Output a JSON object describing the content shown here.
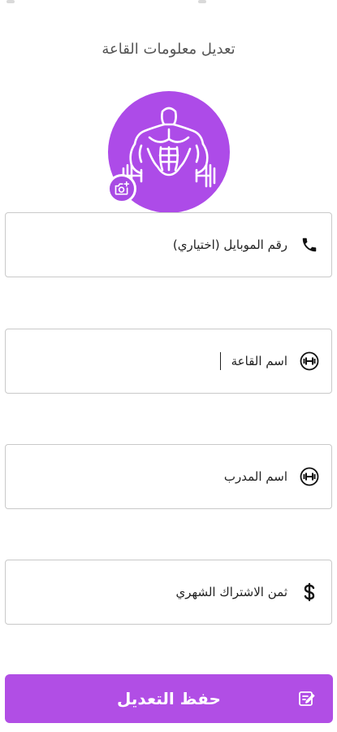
{
  "header": {
    "title": "تعديل معلومات القاعة"
  },
  "avatar": {
    "image_icon": "bodybuilder-dumbbell-icon",
    "badge_icon": "camera-add-icon",
    "background_color": "#ad4be8"
  },
  "form": {
    "fields": [
      {
        "label": "رقم الموبايل (اختياري)",
        "icon": "phone-icon"
      },
      {
        "label": "اسم القاعة",
        "icon": "dumbbell-icon",
        "focused": true
      },
      {
        "label": "اسم المدرب",
        "icon": "dumbbell-icon"
      },
      {
        "label": "ثمن الاشتراك الشهري",
        "icon": "dollar-icon"
      }
    ]
  },
  "actions": {
    "save_label": "حفظ التعديل",
    "save_icon": "edit-note-icon",
    "accent_color": "#b14ee5"
  }
}
